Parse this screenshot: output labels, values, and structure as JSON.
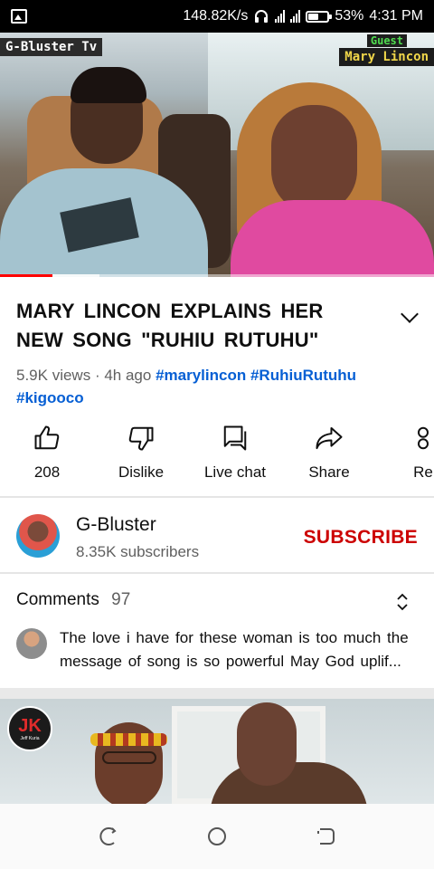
{
  "status_bar": {
    "speed": "148.82K/s",
    "battery_pct": "53%",
    "battery_level": 0.53,
    "time": "4:31 PM",
    "icons": [
      "image-icon",
      "headset-icon",
      "signal-icon",
      "signal-icon",
      "battery-icon"
    ]
  },
  "video": {
    "channel_watermark": "G-Bluster Tv",
    "guest_label": "Guest",
    "guest_name": "Mary Lincon",
    "progress_played": 0.12,
    "progress_buffered": 0.23,
    "accent": "#ff0000"
  },
  "details": {
    "title": "MARY LINCON  EXPLAINS  HER NEW  SONG  \"RUHIU  RUTUHU\"",
    "views": "5.9K views",
    "separator": "·",
    "age": "4h ago",
    "hashtags": [
      "#marylincon",
      "#RuhiuRutuhu",
      "#kigooco"
    ]
  },
  "actions": [
    {
      "label": "208",
      "icon": "thumbs-up-icon"
    },
    {
      "label": "Dislike",
      "icon": "thumbs-down-icon"
    },
    {
      "label": "Live chat",
      "icon": "chat-icon"
    },
    {
      "label": "Share",
      "icon": "share-icon"
    },
    {
      "label": "Re",
      "icon": "remix-icon"
    }
  ],
  "channel": {
    "name": "G-Bluster",
    "subscribers": "8.35K subscribers",
    "subscribe_label": "SUBSCRIBE",
    "subscribe_color": "#cc0000"
  },
  "comments": {
    "label": "Comments",
    "count": "97",
    "top_comment_line1": "The love i have for these woman is too much  the",
    "top_comment_line2": "message  of song is so powerful   May  God uplif..."
  },
  "next_video": {
    "logo_letter": "JK",
    "logo_text": "Jeff Kuria"
  },
  "navigation": [
    "back-icon",
    "home-icon",
    "recents-icon"
  ]
}
